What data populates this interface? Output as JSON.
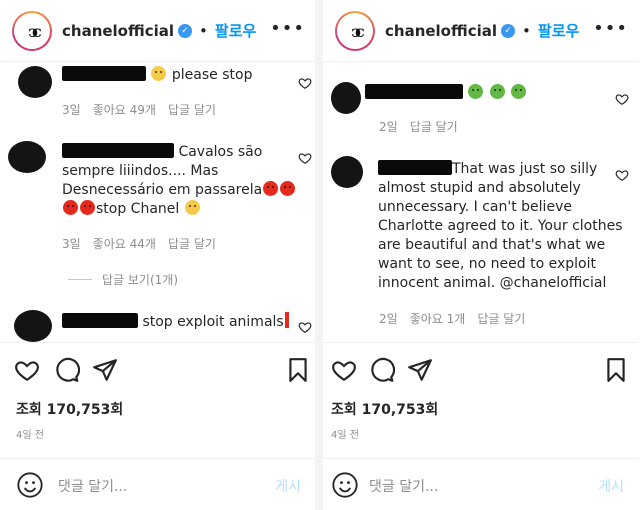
{
  "left": {
    "username": "chanelofficial",
    "separator": "•",
    "follow_label": "팔로우",
    "more_label": "•••",
    "comments": [
      {
        "text": "please stop",
        "meta": [
          "3일",
          "좋아요 49개",
          "답글 달기"
        ]
      },
      {
        "text_line1": "Cavalos são",
        "text_line2": "sempre liiindos.... Mas",
        "text_line3": "Desnecessário em passarela",
        "text_line4": "stop Chanel",
        "meta": [
          "3일",
          "좋아요 44개",
          "답글 달기"
        ],
        "replies": "답글 보기(1개)"
      },
      {
        "text": "stop exploit animals"
      }
    ],
    "views": "조회 170,753회",
    "time_ago": "4일 전",
    "comment_placeholder": "댓글 달기...",
    "post_label": "게시"
  },
  "right": {
    "username": "chanelofficial",
    "separator": "•",
    "follow_label": "팔로우",
    "more_label": "•••",
    "comments": [
      {
        "meta": [
          "2일",
          "답글 달기"
        ]
      },
      {
        "line1": "That was just so silly",
        "line2": "almost stupid and absolutely",
        "line3": "unnecessary. I can't believe",
        "line4": "Charlotte agreed to it. Your clothes",
        "line5": "are beautiful and that's what we",
        "line6": "want to see, no need to exploit",
        "line7": "innocent animal. @chanelofficial",
        "meta": [
          "2일",
          "좋아요 1개",
          "답글 달기"
        ]
      }
    ],
    "views": "조회 170,753회",
    "time_ago": "4일 전",
    "comment_placeholder": "댓글 달기...",
    "post_label": "게시"
  },
  "icons": [
    "heart-icon",
    "comment-icon",
    "share-icon",
    "bookmark-icon",
    "smile-icon",
    "verified-icon",
    "more-icon"
  ],
  "colors": {
    "follow": "#0095f6",
    "muted": "#8e8e8e",
    "verified": "#3897f0",
    "post_disabled": "#b2dffc"
  }
}
